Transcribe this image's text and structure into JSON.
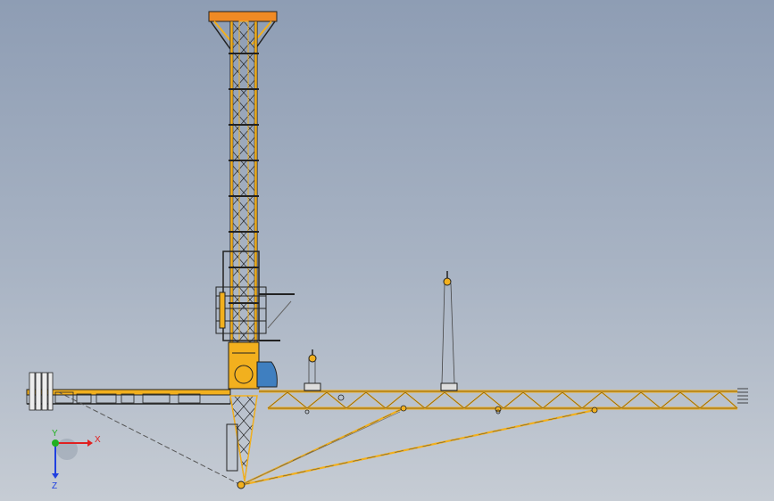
{
  "viewport": {
    "background_top": "#8e9db4",
    "background_bottom": "#c6ccd4"
  },
  "model": {
    "name": "tower crane",
    "structure_color": "#f2b01e",
    "outline_color": "#222222",
    "accent_color": "#f08a24",
    "cab_color": "#3f7fc0",
    "tie_color": "#555555"
  },
  "triad": {
    "x_label": "X",
    "y_label": "Y",
    "z_label": "Z",
    "x_color": "#e02020",
    "y_color": "#20b020",
    "z_color": "#2040e0"
  }
}
